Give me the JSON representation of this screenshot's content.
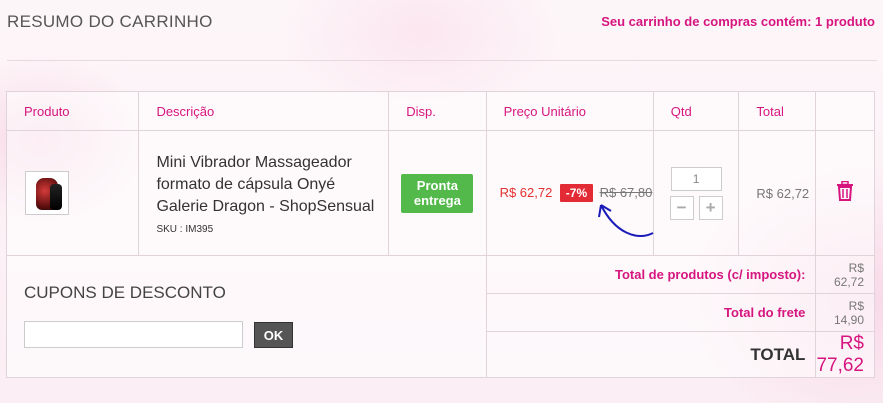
{
  "header": {
    "title": "RESUMO DO CARRINHO",
    "cart_info": "Seu carrinho de compras contém: 1 produto"
  },
  "table": {
    "columns": {
      "produto": "Produto",
      "descricao": "Descrição",
      "disp": "Disp.",
      "preco": "Preço Unitário",
      "qtd": "Qtd",
      "total": "Total"
    }
  },
  "item": {
    "name": "Mini Vibrador Massageador formato de cápsula Onyé Galerie Dragon - ShopSensual",
    "sku": "SKU : IM395",
    "availability": "Pronta entrega",
    "price_new": "R$ 62,72",
    "discount": "-7%",
    "price_old": "R$ 67,80",
    "quantity": "1",
    "qty_minus": "−",
    "qty_plus": "+",
    "total": "R$ 62,72",
    "delete_icon": "trash-icon"
  },
  "coupon": {
    "title": "CUPONS DE DESCONTO",
    "input_value": "",
    "button": "OK"
  },
  "summary": {
    "products_label": "Total de produtos (c/ imposto):",
    "products_value": "R$ 62,72",
    "shipping_label": "Total do frete",
    "shipping_value": "R$ 14,90",
    "total_label": "TOTAL",
    "total_value": "R$ 77,62"
  },
  "colors": {
    "accent": "#d6157f",
    "stock_green": "#52b94a",
    "discount_red": "#e32b36",
    "annotation_blue": "#1a1ab8"
  }
}
